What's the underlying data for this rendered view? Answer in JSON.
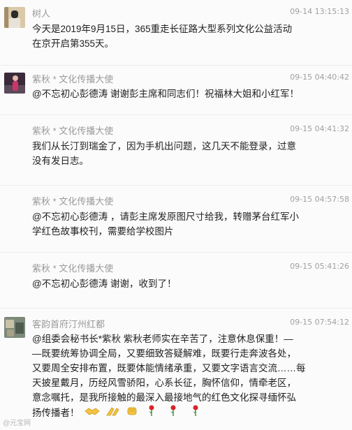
{
  "posts": [
    {
      "name": "树人",
      "time": "09-14 13:15:13",
      "lines": [
        "今天是2019年9月15日，365重走长征路大型系列文化公益活动",
        "在京开启第355天。"
      ]
    },
    {
      "name": "紫秋 * 文化传播大使",
      "time": "09-15 04:40:42",
      "lines": [
        "@不忘初心彭德涛 谢谢彭主席和同志们！祝福林大姐和小红军！"
      ]
    },
    {
      "name": "紫秋 * 文化传播大使",
      "time": "09-15 04:41:32",
      "lines": [
        "我们从长汀到瑞金了，因为手机出问题，这几天不能登录，过意",
        "没有发日志。"
      ]
    },
    {
      "name": "紫秋 * 文化传播大使",
      "time": "09-15 04:57:58",
      "lines": [
        "@不忘初心彭德涛 ，请彭主席发原图尺寸给我，转赠茅台红军小",
        "学红色故事校刊，需要给学校图片"
      ]
    },
    {
      "name": "紫秋 * 文化传播大使",
      "time": "09-15 05:41:26",
      "lines": [
        "@不忘初心彭德涛 谢谢，收到了！"
      ]
    },
    {
      "name": "客韵首府汀州红都",
      "time": "09-15 07:54:12",
      "lines": [
        "@组委会秘书长*紫秋 紫秋老师实在辛苦了，注意休息保重！—",
        "—既要统筹协调全局，又要细致答疑解难，既要行走奔波各处，",
        "又要周全安排布置，既要体能情绪承重，又要文字语言交流……每",
        "天披星戴月，历经风雪骄阳，心系长征，胸怀信仰，情牵老区，",
        "意念嘱托，是我所接触的最深入最接地气的红色文化探寻缅怀弘",
        "扬传播者！"
      ],
      "emoji_icons": [
        "handshake-icon",
        "clap-icon",
        "fist-icon",
        "rose-icon",
        "rose-icon",
        "rose-icon"
      ]
    }
  ],
  "watermark": "@元宝网"
}
